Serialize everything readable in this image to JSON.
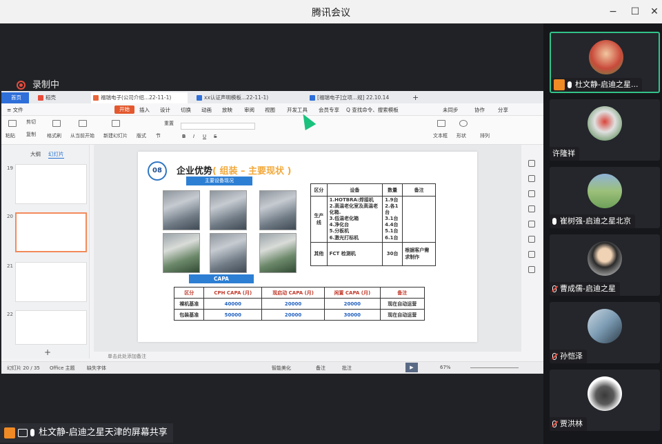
{
  "window": {
    "title": "腾讯会议",
    "controls": [
      "−",
      "☐",
      "✕"
    ]
  },
  "meeting": {
    "recording_label": "录制中",
    "share_label": "杜文静-启迪之星天津的屏幕共享"
  },
  "wps": {
    "tabs": [
      {
        "label": "首页"
      },
      {
        "label": "稻壳"
      },
      {
        "label": "福瑞电子(公司介绍...22-11-1)"
      },
      {
        "label": "xx认证声明模板...22-11-1)"
      },
      {
        "label": "[福瑞电子]立项...规] 22.10.14"
      }
    ],
    "menu": [
      "≡ 文件",
      "开始",
      "插入",
      "设计",
      "切换",
      "动画",
      "放映",
      "审阅",
      "视图",
      "开发工具",
      "会员专享",
      "Q 查找命令、搜索模板",
      "未同步",
      "协作",
      "分享"
    ],
    "ribbon": [
      "粘贴",
      "剪切",
      "复制",
      "格式刷",
      "从当前开始",
      "新建幻灯片",
      "版式",
      "节",
      "重置",
      "文本框",
      "形状",
      "排列"
    ],
    "left_tabs": [
      "大纲",
      "幻灯片"
    ],
    "thumbs": [
      "19",
      "20",
      "21",
      "22"
    ],
    "status": {
      "slide_count": "幻灯片 20 / 35",
      "theme": "Office 主题",
      "font": "缺失字体",
      "beautify": "智能美化",
      "notes": "备注",
      "comments": "批注",
      "zoom": "67%"
    },
    "notes_placeholder": "单击此处添加备注"
  },
  "slide": {
    "number": "08",
    "title": "企业优势",
    "subtitle": "( 组装 – 主要现状 )",
    "equip_header": "主要设备现况",
    "capa_header": "CAPA",
    "table1": {
      "headers": [
        "区分",
        "设备",
        "数量",
        "备注"
      ],
      "row1": {
        "group": "生产线",
        "equipment": [
          "1.HOTBRA:焊接机",
          "2.高温老化室及高温老化箱.",
          "3.低温老化箱",
          "4.净化台",
          "5.分板机",
          "6.激光打标机"
        ],
        "qty": [
          "1.9台",
          "2.各1台",
          "3.1台",
          "4.4台",
          "5.1台",
          "6.1台"
        ],
        "note": ""
      },
      "row2": {
        "group": "其他",
        "equipment": "FCT 检测机",
        "qty": "30台",
        "note": "根据客户需求制作"
      }
    },
    "table2": {
      "headers": [
        "区分",
        "CPH CAPA (月)",
        "现启动 CAPA (月)",
        "闲置 CAPA (月)",
        "备注"
      ],
      "rows": [
        [
          "裸机基准",
          "40000",
          "20000",
          "20000",
          "现在自动运营"
        ],
        [
          "包装基准",
          "50000",
          "20000",
          "30000",
          "现在自动运营"
        ]
      ]
    }
  },
  "participants": [
    {
      "name": "杜文静-启迪之星...",
      "mic": "on",
      "sharing": true,
      "avatar_color": "#c94a3a"
    },
    {
      "name": "许隆祥",
      "mic": "none",
      "sharing": false,
      "avatar_color": "#3e7b3a"
    },
    {
      "name": "崔树强-启迪之星北京",
      "mic": "on",
      "sharing": false,
      "avatar_color": "#6ea05a"
    },
    {
      "name": "曹成儒-启迪之星",
      "mic": "off",
      "sharing": false,
      "avatar_color": "#dcdcdc"
    },
    {
      "name": "孙恺泽",
      "mic": "off",
      "sharing": false,
      "avatar_color": "#7b9bb3"
    },
    {
      "name": "贾洪林",
      "mic": "off",
      "sharing": false,
      "avatar_color": "#ffffff"
    }
  ]
}
